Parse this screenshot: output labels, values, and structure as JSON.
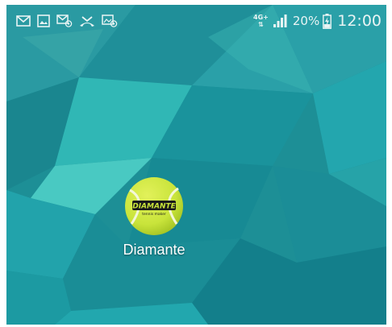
{
  "status_bar": {
    "notification_icons": [
      "email-icon",
      "gallery-icon",
      "email-at-icon",
      "missed-call-icon",
      "image-at-icon"
    ],
    "network_type": "4G+",
    "network_activity": "⇅",
    "signal_icon": "signal-bars-icon",
    "battery_percent": "20%",
    "battery_icon": "battery-charging-icon",
    "time": "12:00"
  },
  "home_screen": {
    "apps": [
      {
        "label": "Diamante",
        "icon": "tennis-ball-icon",
        "icon_text": "DIAMANTE",
        "icon_subtext": "tennis maker"
      }
    ]
  },
  "colors": {
    "wallpaper_base": "#1d8f96",
    "ball_yellow": "#c9e43b",
    "status_text": "#e9f4f4"
  }
}
